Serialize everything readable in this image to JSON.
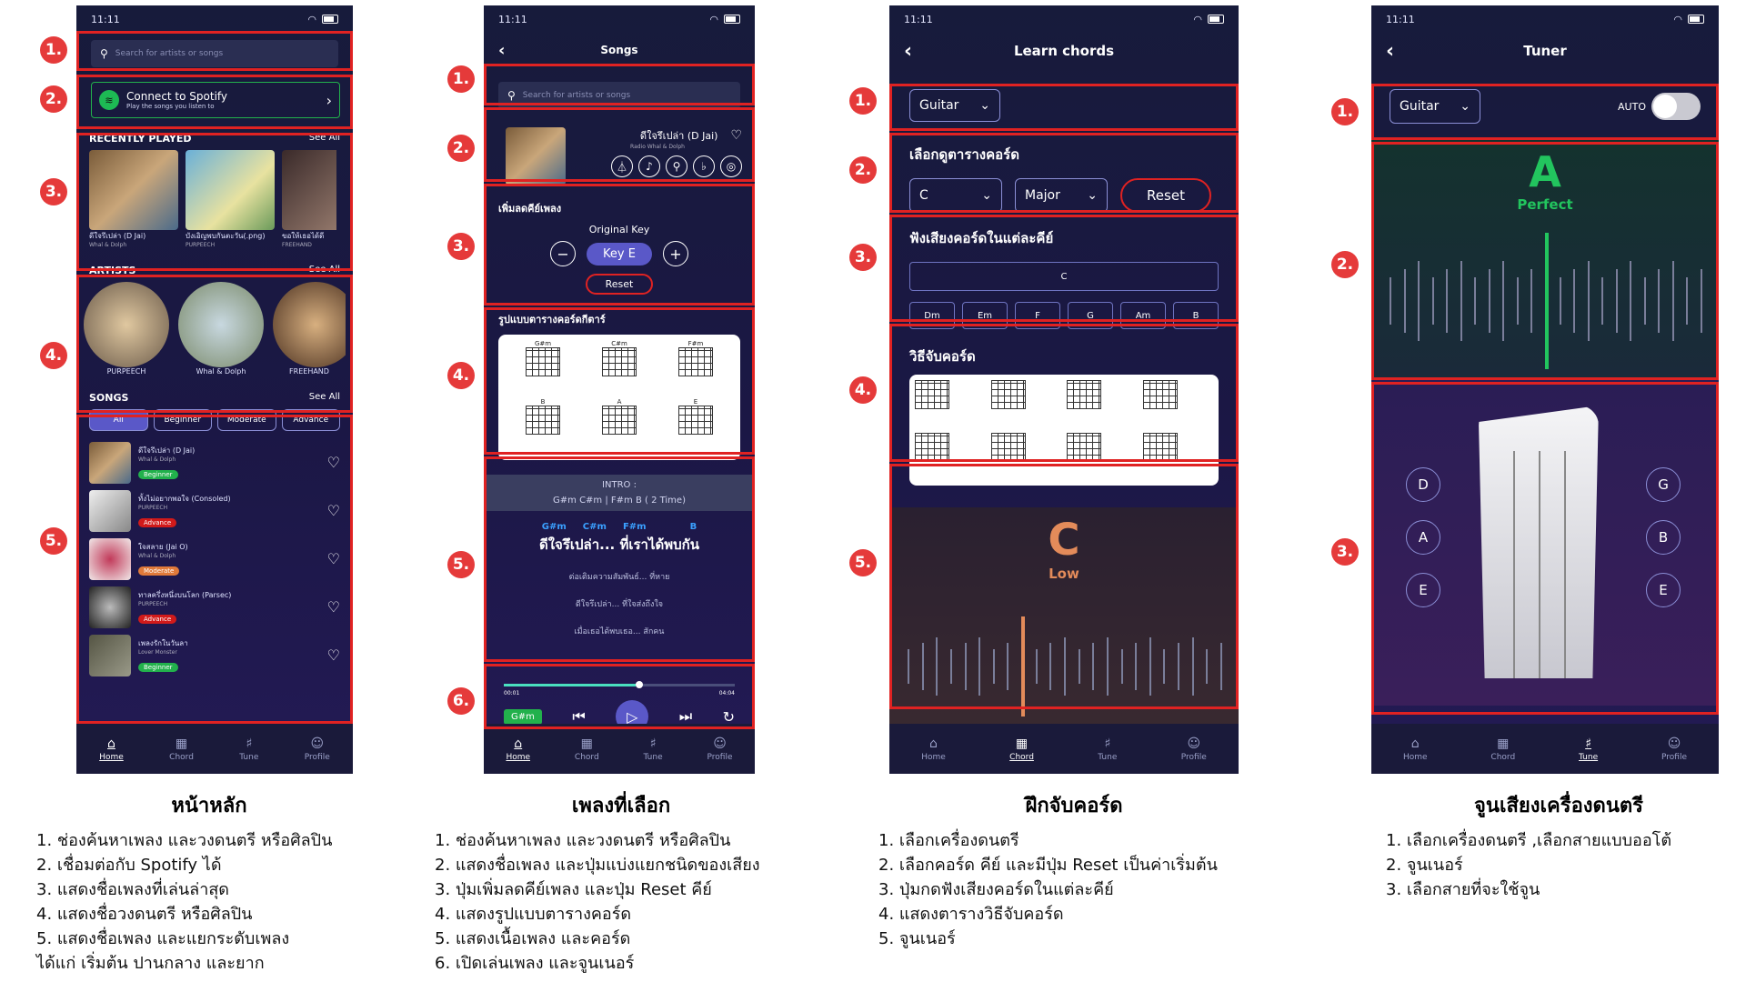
{
  "status_time": "11:11",
  "home": {
    "search_placeholder": "Search for artists or songs",
    "spotify_title": "Connect to Spotify",
    "spotify_sub": "Play the songs you listen to",
    "recent_title": "RECENTLY PLAYED",
    "see_all": "See All",
    "recent": [
      {
        "title": "ดีใจรึเปล่า (D Jai)",
        "artist": "Whal & Dolph"
      },
      {
        "title": "บังเอิญพบกันตะวัน(.png)",
        "artist": "PURPEECH"
      },
      {
        "title": "ขอให้เธอได้ดี",
        "artist": "FREEHAND"
      }
    ],
    "artists_title": "ARTISTS",
    "artists": [
      "PURPEECH",
      "Whal & Dolph",
      "FREEHAND"
    ],
    "songs_title": "SONGS",
    "filters": [
      "All",
      "Beginner",
      "Moderate",
      "Advance"
    ],
    "songs": [
      {
        "title": "ดีใจรึเปล่า (D Jai)",
        "artist": "Whal & Dolph",
        "level": "Beginner",
        "color": "#22b14c"
      },
      {
        "title": "ทั้งไม่อยากพอใจ (Consoled)",
        "artist": "PURPEECH",
        "level": "Advance",
        "color": "#d11a1a"
      },
      {
        "title": "ใจสลาย (Jai O)",
        "artist": "Whal & Dolph",
        "level": "Moderate",
        "color": "#e07a3a"
      },
      {
        "title": "ทาลครึ่งหนึ่งบนโลก (Parsec)",
        "artist": "PURPEECH",
        "level": "Advance",
        "color": "#d11a1a"
      },
      {
        "title": "เพลงรักในวันลา",
        "artist": "Lover Monster",
        "level": "Beginner",
        "color": "#22b14c"
      }
    ]
  },
  "nav": {
    "home": "Home",
    "chord": "Chord",
    "tune": "Tune",
    "profile": "Profile"
  },
  "song": {
    "header": "Songs",
    "title": "ดีใจรึเปล่า (D Jai)",
    "artist": "Radio Whal & Dolph",
    "key_section": "เพิ่มลดคีย์เพลง",
    "original_key": "Original Key",
    "key": "Key E",
    "reset": "Reset",
    "chord_section": "รูปแบบตารางคอร์ดกีตาร์",
    "chords": [
      "G#m",
      "C#m",
      "F#m",
      "B",
      "A",
      "E"
    ],
    "intro": "INTRO :",
    "intro_chords": "G#m C#m | F#m B ( 2 Time)",
    "lyric_chords": [
      "G#m",
      "C#m",
      "F#m",
      "B"
    ],
    "lyric_main": "ดีใจรึเปล่า... ที่เราได้พบกัน",
    "lyric_lines": [
      "ต่อเติมความสัมพันธ์... ที่หาย",
      "ดีใจรึเปล่า... ที่ใจส่งถึงใจ",
      "เมื่อเธอได้พบเธอ... สักคน"
    ],
    "time_start": "00:01",
    "time_end": "04:04",
    "current_chord": "G#m"
  },
  "chord": {
    "header": "Learn chords",
    "instrument": "Guitar",
    "select_title": "เลือกดูตารางคอร์ด",
    "root": "C",
    "quality": "Major",
    "reset": "Reset",
    "listen_title": "ฟังเสียงคอร์ดในแต่ละคีย์",
    "selected": "C",
    "keys": [
      "Dm",
      "Em",
      "F",
      "G",
      "Am",
      "B"
    ],
    "how_title": "วิธีจับคอร์ด",
    "note": "C",
    "status": "Low"
  },
  "tuner": {
    "header": "Tuner",
    "instrument": "Guitar",
    "auto": "AUTO",
    "note": "A",
    "status": "Perfect",
    "left_strings": [
      "D",
      "A",
      "E"
    ],
    "right_strings": [
      "G",
      "B",
      "E"
    ]
  },
  "descriptions": [
    {
      "title": "หน้าหลัก",
      "lines": [
        "1. ช่องค้นหาเพลง และวงดนตรี หรือศิลปิน",
        "2. เชื่อมต่อกับ Spotify ได้",
        "3. แสดงชื่อเพลงที่เล่นล่าสุด",
        "4. แสดงชื่อวงดนตรี หรือศิลปิน",
        "5. แสดงชื่อเพลง และแยกระดับเพลง",
        "ได้แก่ เริ่มต้น ปานกลาง และยาก"
      ]
    },
    {
      "title": "เพลงที่เลือก",
      "lines": [
        "1. ช่องค้นหาเพลง และวงดนตรี หรือศิลปิน",
        "2. แสดงชื่อเพลง และปุ่มแบ่งแยกชนิดของเสียง",
        "3. ปุ่มเพิ่มลดคีย์เพลง และปุ่ม Reset คีย์",
        "4. แสดงรูปแบบตารางคอร์ด",
        "5. แสดงเนื้อเพลง และคอร์ด",
        "6. เปิดเล่นเพลง และจูนเนอร์"
      ]
    },
    {
      "title": "ฝึกจับคอร์ด",
      "lines": [
        "1. เลือกเครื่องดนตรี",
        "2. เลือกคอร์ด คีย์ และมีปุ่ม Reset เป็นค่าเริ่มต้น",
        "3. ปุ่มกดฟังเสียงคอร์ดในแต่ละคีย์",
        "4. แสดงตารางวิธีจับคอร์ด",
        "5. จูนเนอร์"
      ]
    },
    {
      "title": "จูนเสียงเครื่องดนตรี",
      "lines": [
        "1. เลือกเครื่องดนตรี ,เลือกสายแบบออโต้",
        "2. จูนเนอร์",
        "3. เลือกสายที่จะใช้จูน"
      ]
    }
  ]
}
